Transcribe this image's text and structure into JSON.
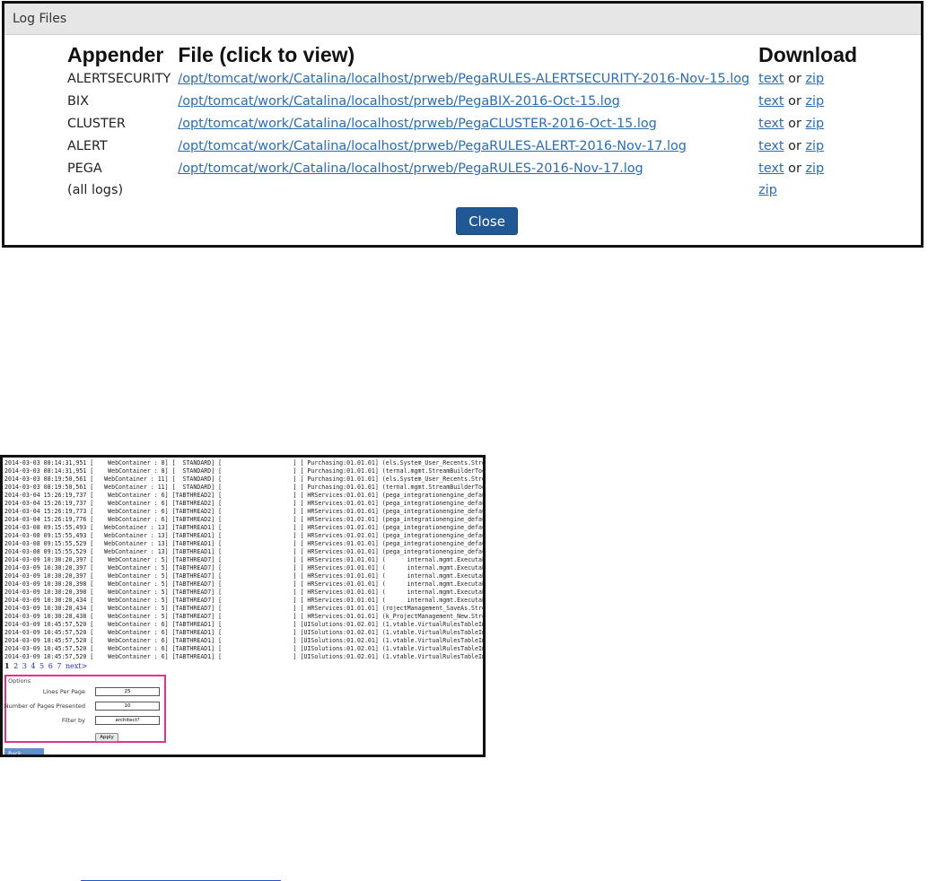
{
  "dialog": {
    "title": "Log Files",
    "headers": {
      "appender": "Appender",
      "file": "File (click to view)",
      "download": "Download"
    },
    "rows": [
      {
        "appender": "ALERTSECURITY",
        "file": "/opt/tomcat/work/Catalina/localhost/prweb/PegaRULES-ALERTSECURITY-2016-Nov-15.log",
        "text": "text",
        "or": "or",
        "zip": "zip"
      },
      {
        "appender": "BIX",
        "file": "/opt/tomcat/work/Catalina/localhost/prweb/PegaBIX-2016-Oct-15.log",
        "text": "text",
        "or": "or",
        "zip": "zip"
      },
      {
        "appender": "CLUSTER",
        "file": "/opt/tomcat/work/Catalina/localhost/prweb/PegaCLUSTER-2016-Oct-15.log",
        "text": "text",
        "or": "or",
        "zip": "zip"
      },
      {
        "appender": "ALERT",
        "file": "/opt/tomcat/work/Catalina/localhost/prweb/PegaRULES-ALERT-2016-Nov-17.log",
        "text": "text",
        "or": "or",
        "zip": "zip"
      },
      {
        "appender": "PEGA",
        "file": "/opt/tomcat/work/Catalina/localhost/prweb/PegaRULES-2016-Nov-17.log",
        "text": "text",
        "or": "or",
        "zip": "zip"
      },
      {
        "appender": "(all logs)",
        "file": "",
        "text": "",
        "or": "",
        "zip": "zip"
      }
    ],
    "close_label": "Close"
  },
  "viewer": {
    "lines": [
      "2014-03-03 08:14:31,951 [    WebContainer : 8] [  STANDARD] [                    ] [ Purchasing:01.01.01] (els.System_User_Recents.Stre",
      "2014-03-03 08:14:31,951 [    WebContainer : 8] [  STANDARD] [                    ] [ Purchasing:01.01.01] (ternal.mgmt.StreamBuilderToo",
      "2014-03-03 08:19:50,561 [   WebContainer : 11] [  STANDARD] [                    ] [ Purchasing:01.01.01] (els.System_User_Recents.Stre",
      "2014-03-03 08:19:50,561 [   WebContainer : 11] [  STANDARD] [                    ] [ Purchasing:01.01.01] (ternal.mgmt.StreamBuilderToo",
      "2014-03-04 15:26:19,737 [    WebContainer : 6] [TABTHREAD2] [                    ] [ HRServices:01.01.01] (pega_integrationengine_defau",
      "2014-03-04 15:26:19,737 [    WebContainer : 6] [TABTHREAD2] [                    ] [ HRServices:01.01.01] (pega_integrationengine_defau",
      "2014-03-04 15:26:19,773 [    WebContainer : 6] [TABTHREAD2] [                    ] [ HRServices:01.01.01] (pega_integrationengine_defau",
      "2014-03-04 15:26:19,776 [    WebContainer : 6] [TABTHREAD2] [                    ] [ HRServices:01.01.01] (pega_integrationengine_defau",
      "2014-03-08 09:15:55,493 [   WebContainer : 13] [TABTHREAD1] [                    ] [ HRServices:01.01.01] (pega_integrationengine_defau",
      "2014-03-08 09:15:55,493 [   WebContainer : 13] [TABTHREAD1] [                    ] [ HRServices:01.01.01] (pega_integrationengine_defau",
      "2014-03-08 09:15:55,529 [   WebContainer : 13] [TABTHREAD1] [                    ] [ HRServices:01.01.01] (pega_integrationengine_defau",
      "2014-03-08 09:15:55,529 [   WebContainer : 13] [TABTHREAD1] [                    ] [ HRServices:01.01.01] (pega_integrationengine_defau",
      "2014-03-09 10:30:20,397 [    WebContainer : 5] [TABTHREAD7] [                    ] [ HRServices:01.01.01] (      internal.mgmt.Executab",
      "2014-03-09 10:30:20,397 [    WebContainer : 5] [TABTHREAD7] [                    ] [ HRServices:01.01.01] (      internal.mgmt.Executab",
      "2014-03-09 10:30:20,397 [    WebContainer : 5] [TABTHREAD7] [                    ] [ HRServices:01.01.01] (      internal.mgmt.Executab",
      "2014-03-09 10:30:20,398 [    WebContainer : 5] [TABTHREAD7] [                    ] [ HRServices:01.01.01] (      internal.mgmt.Executab",
      "2014-03-09 10:30:20,398 [    WebContainer : 5] [TABTHREAD7] [                    ] [ HRServices:01.01.01] (      internal.mgmt.Executab",
      "2014-03-09 10:30:20,434 [    WebContainer : 5] [TABTHREAD7] [                    ] [ HRServices:01.01.01] (      internal.mgmt.Executab",
      "2014-03-09 10:30:20,434 [    WebContainer : 5] [TABTHREAD7] [                    ] [ HRServices:01.01.01] (rojectManagement_SaveAs.Stre",
      "2014-03-09 10:30:20,438 [    WebContainer : 5] [TABTHREAD7] [                    ] [ HRServices:01.01.01] (k_ProjectManagement_New.Stre",
      "2014-03-09 10:45:57,520 [    WebContainer : 6] [TABTHREAD1] [                    ] [UISolutions:01.02.01] (1.vtable.VirtualRulesTableIm",
      "2014-03-09 10:45:57,520 [    WebContainer : 6] [TABTHREAD1] [                    ] [UISolutions:01.02.01] (1.vtable.VirtualRulesTableIm",
      "2014-03-09 10:45:57,520 [    WebContainer : 6] [TABTHREAD1] [                    ] [UISolutions:01.02.01] (1.vtable.VirtualRulesTableIm",
      "2014-03-09 10:45:57,520 [    WebContainer : 6] [TABTHREAD1] [                    ] [UISolutions:01.02.01] (1.vtable.VirtualRulesTableIm",
      "2014-03-09 10:45:57,520 [    WebContainer : 6] [TABTHREAD1] [                    ] [UISolutions:01.02.01] (1.vtable.VirtualRulesTableIm"
    ],
    "pages": [
      "1",
      "2",
      "3",
      "4",
      "5",
      "6",
      "7"
    ],
    "next_label": "next>",
    "options": {
      "title": "Options",
      "lines_per_page_label": "Lines Per Page",
      "lines_per_page_value": "25",
      "pages_presented_label": "Number of Pages Presented",
      "pages_presented_value": "10",
      "filter_label": "Filter by",
      "filter_value": "architect?",
      "apply_label": "Apply"
    },
    "back_label": "Back"
  },
  "colors": {
    "link": "#2a6db0",
    "close_button": "#1f5895",
    "options_border": "#e0338a",
    "back_button": "#5f8fd0"
  }
}
